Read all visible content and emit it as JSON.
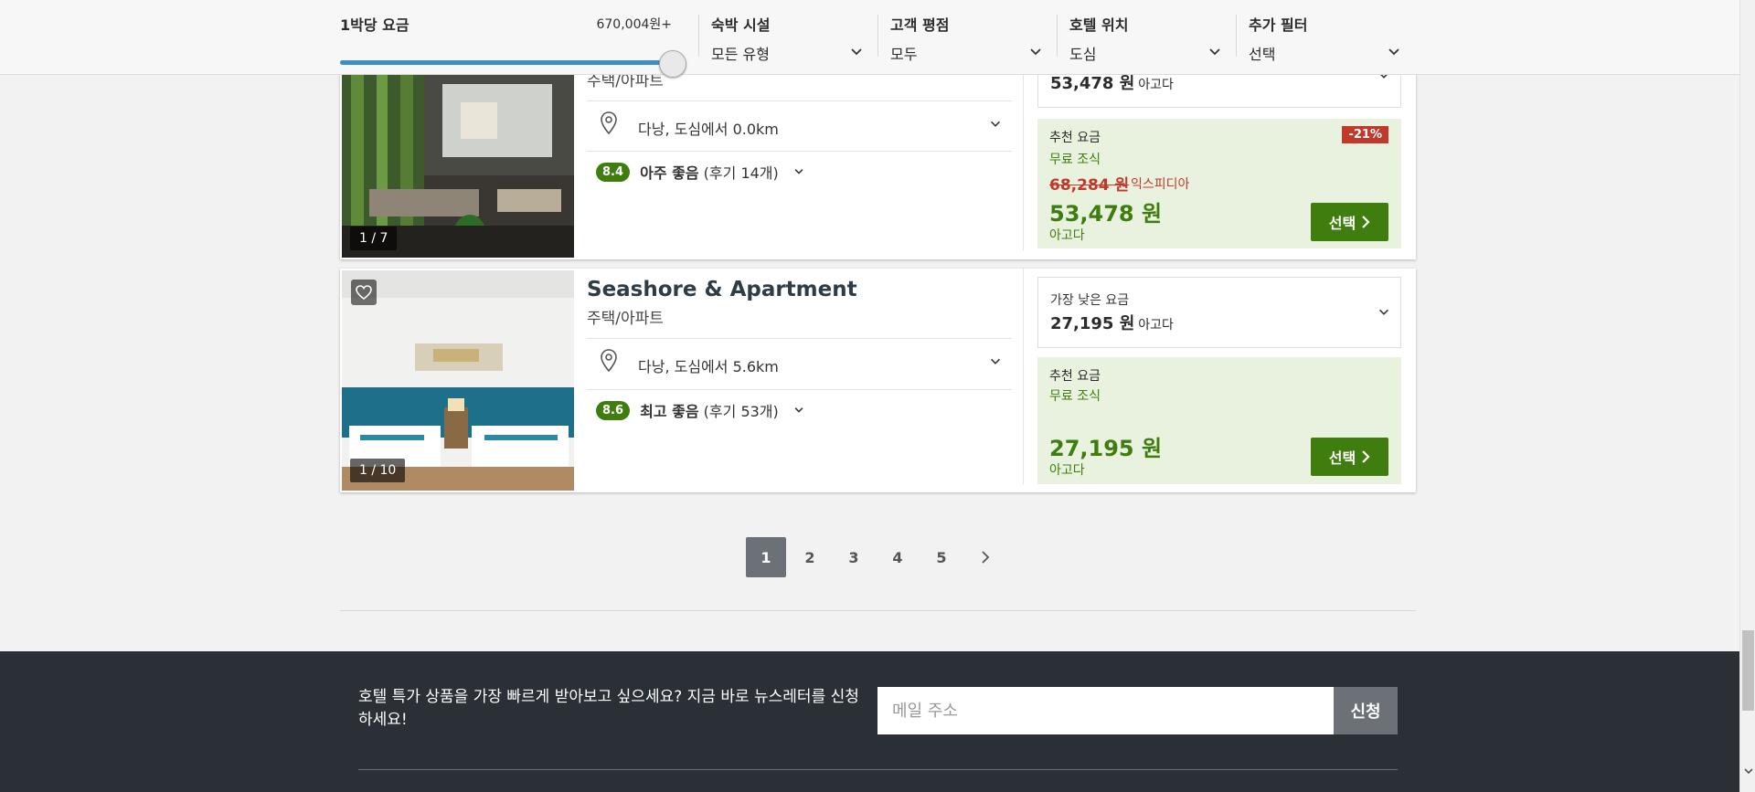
{
  "filters": {
    "price": {
      "label": "1박당 요금",
      "max": "670,004원+",
      "slider_fraction": 1.0
    },
    "accommodation": {
      "label": "숙박 시설",
      "value": "모든 유형"
    },
    "rating": {
      "label": "고객 평점",
      "value": "모두"
    },
    "location": {
      "label": "호텔 위치",
      "value": "도심"
    },
    "more": {
      "label": "추가 필터",
      "value": "선택"
    }
  },
  "hotels": [
    {
      "type": "주택/아파트",
      "photo_counter": "1 / 7",
      "location": "다낭, 도심에서 0.0km",
      "rating_score": "8.4",
      "rating_word": "아주 좋음",
      "rating_reviews": "(후기 14개)",
      "lowest_price": "53,478 원",
      "lowest_source": "아고다",
      "rec_title": "추천 요금",
      "breakfast": "무료 조식",
      "original_price": "68,284 원",
      "original_source": "익스피디아",
      "discount": "-21%",
      "rec_price": "53,478 원",
      "rec_source": "아고다",
      "select_label": "선택"
    },
    {
      "name": "Seashore & Apartment",
      "type": "주택/아파트",
      "photo_counter": "1 / 10",
      "location": "다낭, 도심에서 5.6km",
      "rating_score": "8.6",
      "rating_word": "최고 좋음",
      "rating_reviews": "(후기 53개)",
      "lowest_title": "가장 낮은 요금",
      "lowest_price": "27,195 원",
      "lowest_source": "아고다",
      "rec_title": "추천 요금",
      "breakfast": "무료 조식",
      "rec_price": "27,195 원",
      "rec_source": "아고다",
      "select_label": "선택"
    }
  ],
  "pagination": {
    "pages": [
      "1",
      "2",
      "3",
      "4",
      "5"
    ],
    "current": "1",
    "next_icon": "chevron-right-icon"
  },
  "newsletter": {
    "text": "호텔 특가 상품을 가장 빠르게 받아보고 싶으세요? 지금 바로 뉴스레터를 신청하세요!",
    "placeholder": "메일 주소",
    "button": "신청"
  },
  "colors": {
    "accent_green": "#3f7d0e",
    "discount_red": "#c0392b",
    "slider_blue": "#3d8fc0",
    "footer_bg": "#2b2f36"
  }
}
